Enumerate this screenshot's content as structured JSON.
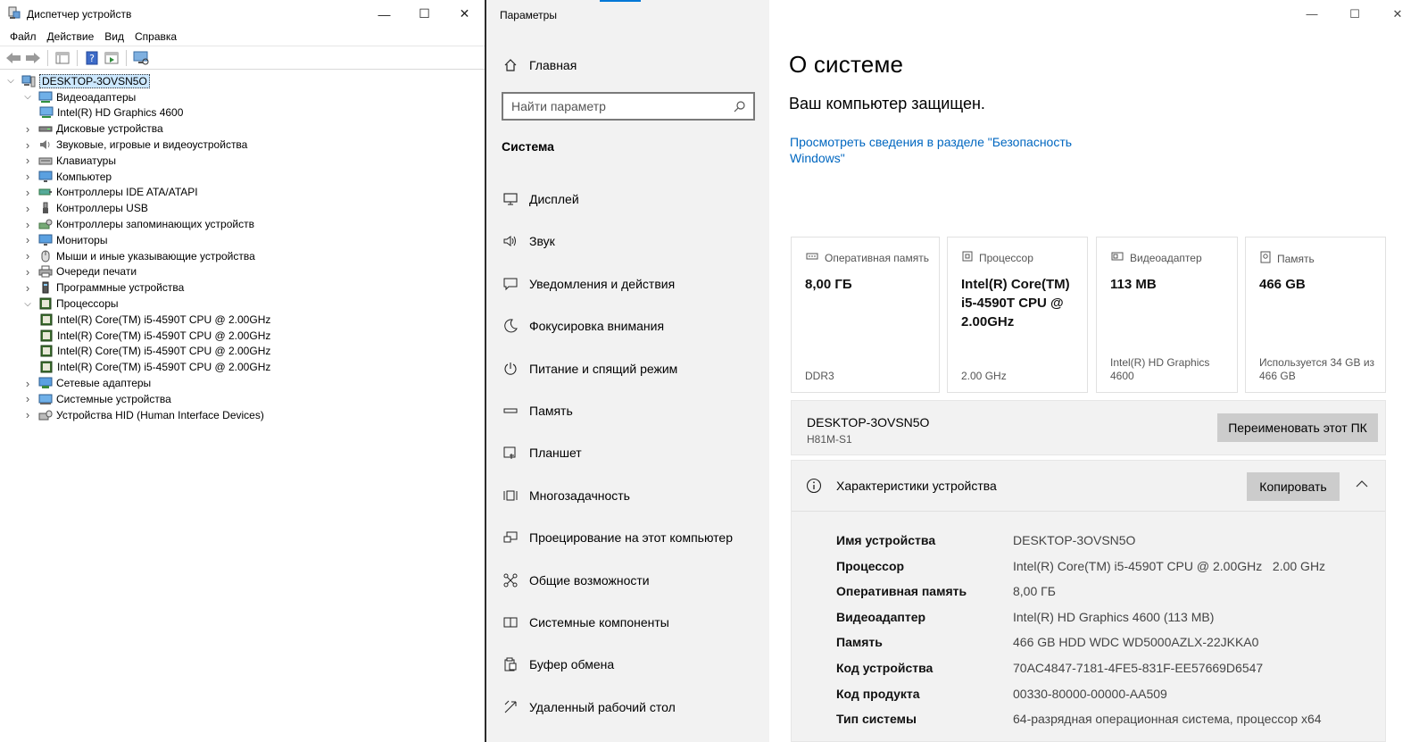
{
  "device_manager": {
    "title": "Диспетчер устройств",
    "menu": [
      "Файл",
      "Действие",
      "Вид",
      "Справка"
    ],
    "window_buttons": {
      "minimize": "—",
      "maximize": "☐",
      "close": "✕"
    },
    "tree": [
      {
        "label": "DESKTOP-3OVSN5O",
        "level": 0,
        "expanded": true,
        "selected": true,
        "icon": "computer-icon"
      },
      {
        "label": "Видеоадаптеры",
        "level": 1,
        "expanded": true,
        "icon": "display-adapter-icon"
      },
      {
        "label": "Intel(R) HD Graphics 4600",
        "level": 2,
        "icon": "display-adapter-icon"
      },
      {
        "label": "Дисковые устройства",
        "level": 1,
        "expanded": false,
        "icon": "disk-icon"
      },
      {
        "label": "Звуковые, игровые и видеоустройства",
        "level": 1,
        "expanded": false,
        "icon": "speaker-icon"
      },
      {
        "label": "Клавиатуры",
        "level": 1,
        "expanded": false,
        "icon": "keyboard-icon"
      },
      {
        "label": "Компьютер",
        "level": 1,
        "expanded": false,
        "icon": "monitor-icon"
      },
      {
        "label": "Контроллеры IDE ATA/ATAPI",
        "level": 1,
        "expanded": false,
        "icon": "ide-controller-icon"
      },
      {
        "label": "Контроллеры USB",
        "level": 1,
        "expanded": false,
        "icon": "usb-icon"
      },
      {
        "label": "Контроллеры запоминающих устройств",
        "level": 1,
        "expanded": false,
        "icon": "storage-controller-icon"
      },
      {
        "label": "Мониторы",
        "level": 1,
        "expanded": false,
        "icon": "monitor-icon"
      },
      {
        "label": "Мыши и иные указывающие устройства",
        "level": 1,
        "expanded": false,
        "icon": "mouse-icon"
      },
      {
        "label": "Очереди печати",
        "level": 1,
        "expanded": false,
        "icon": "printer-icon"
      },
      {
        "label": "Программные устройства",
        "level": 1,
        "expanded": false,
        "icon": "software-device-icon"
      },
      {
        "label": "Процессоры",
        "level": 1,
        "expanded": true,
        "icon": "processor-icon"
      },
      {
        "label": "Intel(R) Core(TM) i5-4590T CPU @ 2.00GHz",
        "level": 2,
        "icon": "processor-icon"
      },
      {
        "label": "Intel(R) Core(TM) i5-4590T CPU @ 2.00GHz",
        "level": 2,
        "icon": "processor-icon"
      },
      {
        "label": "Intel(R) Core(TM) i5-4590T CPU @ 2.00GHz",
        "level": 2,
        "icon": "processor-icon"
      },
      {
        "label": "Intel(R) Core(TM) i5-4590T CPU @ 2.00GHz",
        "level": 2,
        "icon": "processor-icon"
      },
      {
        "label": "Сетевые адаптеры",
        "level": 1,
        "expanded": false,
        "icon": "network-adapter-icon"
      },
      {
        "label": "Системные устройства",
        "level": 1,
        "expanded": false,
        "icon": "system-device-icon"
      },
      {
        "label": "Устройства HID (Human Interface Devices)",
        "level": 1,
        "expanded": false,
        "icon": "hid-icon"
      }
    ]
  },
  "settings": {
    "app_title": "Параметры",
    "accent_color": "#0078d7",
    "home_label": "Главная",
    "search_placeholder": "Найти параметр",
    "section_label": "Система",
    "nav": [
      {
        "label": "Дисплей",
        "icon": "display-icon"
      },
      {
        "label": "Звук",
        "icon": "sound-icon"
      },
      {
        "label": "Уведомления и действия",
        "icon": "notifications-icon"
      },
      {
        "label": "Фокусировка внимания",
        "icon": "focus-assist-icon"
      },
      {
        "label": "Питание и спящий режим",
        "icon": "power-icon"
      },
      {
        "label": "Память",
        "icon": "storage-icon"
      },
      {
        "label": "Планшет",
        "icon": "tablet-icon"
      },
      {
        "label": "Многозадачность",
        "icon": "multitasking-icon"
      },
      {
        "label": "Проецирование на этот компьютер",
        "icon": "projecting-icon"
      },
      {
        "label": "Общие возможности",
        "icon": "shared-experiences-icon"
      },
      {
        "label": "Системные компоненты",
        "icon": "system-components-icon"
      },
      {
        "label": "Буфер обмена",
        "icon": "clipboard-icon"
      },
      {
        "label": "Удаленный рабочий стол",
        "icon": "remote-desktop-icon"
      }
    ],
    "page_title": "О системе",
    "protection_status": "Ваш компьютер защищен.",
    "security_link": "Просмотреть сведения в разделе \"Безопасность Windows\"",
    "cards": [
      {
        "header": "Оперативная память",
        "value": "8,00 ГБ",
        "footer": "DDR3",
        "icon": "ram-icon"
      },
      {
        "header": "Процессор",
        "value": "Intel(R) Core(TM) i5-4590T CPU @ 2.00GHz",
        "footer": "2.00 GHz",
        "icon": "processor-icon"
      },
      {
        "header": "Видеоадаптер",
        "value": "113 MB",
        "footer": "Intel(R) HD Graphics 4600",
        "icon": "gpu-icon"
      },
      {
        "header": "Память",
        "value": "466 GB",
        "footer": "Используется 34 GB из 466 GB",
        "icon": "storage-icon"
      }
    ],
    "pc_name": "DESKTOP-3OVSN5O",
    "pc_model": "H81M-S1",
    "rename_button": "Переименовать этот ПК",
    "specs_title": "Характеристики устройства",
    "copy_button": "Копировать",
    "specs": [
      {
        "key": "Имя устройства",
        "value": "DESKTOP-3OVSN5O"
      },
      {
        "key": "Процессор",
        "value": "Intel(R) Core(TM) i5-4590T CPU @ 2.00GHz   2.00 GHz"
      },
      {
        "key": "Оперативная память",
        "value": "8,00 ГБ"
      },
      {
        "key": "Видеоадаптер",
        "value": "Intel(R) HD Graphics 4600 (113 MB)"
      },
      {
        "key": "Память",
        "value": "466 GB HDD WDC WD5000AZLX-22JKKA0"
      },
      {
        "key": "Код устройства",
        "value": "70AC4847-7181-4FE5-831F-EE57669D6547"
      },
      {
        "key": "Код продукта",
        "value": "00330-80000-00000-AA509"
      },
      {
        "key": "Тип системы",
        "value": "64-разрядная операционная система, процессор x64"
      }
    ]
  }
}
